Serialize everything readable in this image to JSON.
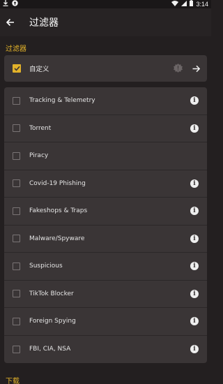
{
  "status_bar": {
    "time": "3:14"
  },
  "header": {
    "title": "过滤器"
  },
  "section_filters_label": "过滤器",
  "custom_filter": {
    "label": "自定义",
    "checked": true
  },
  "filters": [
    {
      "label": "Tracking & Telemetry",
      "checked": false,
      "info": true
    },
    {
      "label": "Torrent",
      "checked": false,
      "info": true
    },
    {
      "label": "Piracy",
      "checked": false,
      "info": false
    },
    {
      "label": "Covid-19 Phishing",
      "checked": false,
      "info": true
    },
    {
      "label": "Fakeshops & Traps",
      "checked": false,
      "info": true
    },
    {
      "label": "Malware/Spyware",
      "checked": false,
      "info": true
    },
    {
      "label": "Suspicious",
      "checked": false,
      "info": true
    },
    {
      "label": "TikTok Blocker",
      "checked": false,
      "info": true
    },
    {
      "label": "Foreign Spying",
      "checked": false,
      "info": true
    },
    {
      "label": "FBI, CIA, NSA",
      "checked": false,
      "info": true
    }
  ],
  "section_download_label": "下载",
  "colors": {
    "accent": "#e2b22a",
    "background": "#231f20",
    "card": "#3a3536"
  }
}
